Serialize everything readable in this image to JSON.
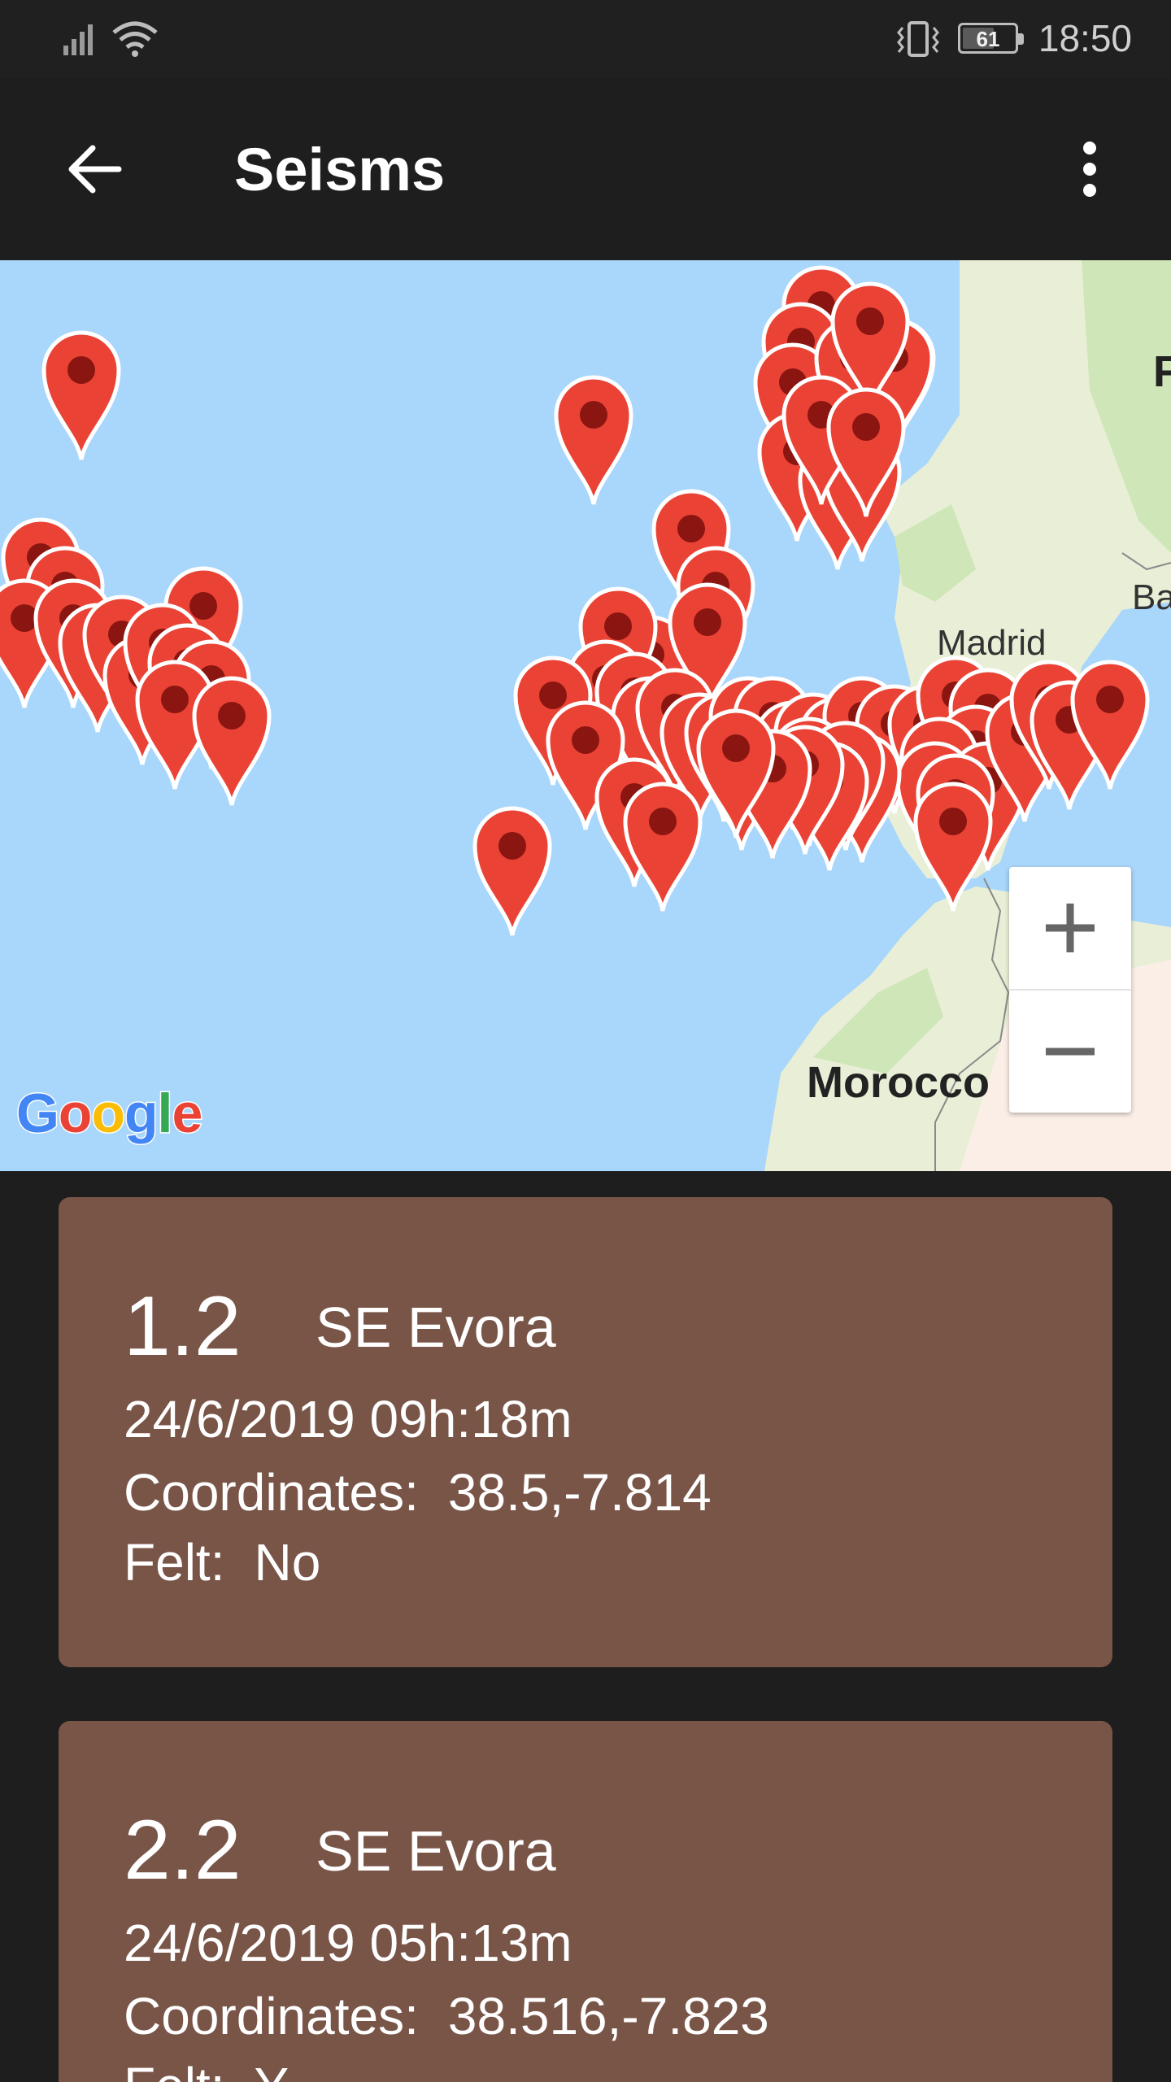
{
  "status_bar": {
    "time": "18:50",
    "battery_level": "61",
    "battery_fraction": 0.61,
    "icons": [
      "signal-icon",
      "wifi-icon",
      "vibrate-icon",
      "battery-icon"
    ]
  },
  "app_bar": {
    "title": "Seisms",
    "back_icon": "arrow-back-icon",
    "menu_icon": "more-vert-icon"
  },
  "map": {
    "labels": {
      "madrid": "Madrid",
      "morocco": "Morocco",
      "partial_top_right": "F",
      "partial_right": "Ba"
    },
    "attribution": "Google",
    "zoom_in_label": "+",
    "zoom_out_label": "−",
    "colors": {
      "water": "#a9d6fb",
      "land": "#e8efd6",
      "land_green": "#cfe6b8",
      "pin": "#ea4335",
      "pin_dot": "#8b1510"
    }
  },
  "cards": [
    {
      "magnitude": "1.2",
      "location": "SE Evora",
      "datetime": "24/6/2019 09h:18m",
      "coordinates_label": "Coordinates:",
      "coordinates_value": "38.5,-7.814",
      "felt_label": "Felt:",
      "felt_value": "No"
    },
    {
      "magnitude": "2.2",
      "location": "SE Evora",
      "datetime": "24/6/2019 05h:13m",
      "coordinates_label": "Coordinates:",
      "coordinates_value": "38.516,-7.823",
      "felt_label": "Felt:",
      "felt_value": "Y"
    }
  ],
  "card_color": "#795548"
}
